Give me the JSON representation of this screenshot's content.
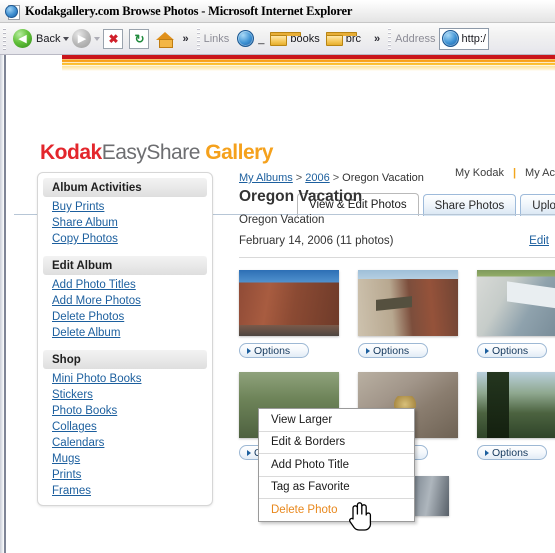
{
  "window": {
    "title": "Kodakgallery.com  Browse Photos - Microsoft Internet Explorer",
    "app_icon": "ie-page-icon"
  },
  "toolbar": {
    "back_label": "Back",
    "forward_label": "",
    "stop_icon": "stop-icon",
    "refresh_icon": "refresh-icon",
    "home_icon": "home-icon",
    "overflow_label": "»",
    "links_label": "Links",
    "link_items": [
      {
        "label": "_",
        "icon": "ie-globe-icon"
      },
      {
        "label": "books",
        "icon": "folder-icon"
      },
      {
        "label": "brc",
        "icon": "folder-icon"
      }
    ],
    "links_overflow_label": "»",
    "address_label": "Address",
    "address_value": "http:/"
  },
  "brand": {
    "kodak": "Kodak",
    "easyshare": "EasyShare",
    "gallery": "Gallery",
    "band_colors": [
      "#c9151b",
      "#f79a15",
      "#fbb927",
      "#fde29a"
    ]
  },
  "top_links": [
    {
      "label": "My Kodak"
    },
    {
      "label": "My Ac"
    }
  ],
  "tabs": [
    {
      "label": "View & Edit Photos",
      "active": true
    },
    {
      "label": "Share Photos",
      "active": false
    },
    {
      "label": "Uplo",
      "active": false
    }
  ],
  "sidebar": {
    "sections": [
      {
        "heading": "Album Activities",
        "links": [
          "Buy Prints",
          "Share Album",
          "Copy Photos"
        ]
      },
      {
        "heading": "Edit Album",
        "links": [
          "Add Photo Titles",
          "Add More Photos",
          "Delete Photos",
          "Delete Album"
        ]
      },
      {
        "heading": "Shop",
        "links": [
          "Mini Photo Books",
          "Stickers",
          "Photo Books",
          "Collages",
          "Calendars",
          "Mugs",
          "Prints",
          "Frames"
        ]
      }
    ]
  },
  "main": {
    "breadcrumb": {
      "root": "My Albums",
      "sep1": ">",
      "year": "2006",
      "sep2": ">",
      "current": "Oregon Vacation"
    },
    "album_title": "Oregon Vacation",
    "album_description": "Oregon Vacation",
    "album_meta": "February 14, 2006 (11 photos)",
    "edit_link": "Edit",
    "options_label": "Options",
    "photos": [
      {
        "id": "photo-1",
        "alt": "brick-building",
        "style": "ph1"
      },
      {
        "id": "photo-2",
        "alt": "storefront-street",
        "style": "ph2"
      },
      {
        "id": "photo-3",
        "alt": "house-awning",
        "style": "ph3"
      },
      {
        "id": "photo-4",
        "alt": "rock-close-up",
        "style": "ph4"
      },
      {
        "id": "photo-5",
        "alt": "trees-landscape",
        "style": "ph5"
      },
      {
        "id": "photo-6",
        "alt": "grass-field",
        "style": "ph7"
      },
      {
        "id": "photo-7",
        "alt": "building-partial",
        "style": "ph6"
      }
    ]
  },
  "context_menu": {
    "items": [
      {
        "label": "View Larger",
        "highlighted": false
      },
      {
        "label": "Edit & Borders",
        "highlighted": false
      },
      {
        "label": "Add Photo Title",
        "highlighted": false
      },
      {
        "label": "Tag as Favorite",
        "highlighted": false
      },
      {
        "label": "Delete Photo",
        "highlighted": true
      }
    ],
    "highlight_color": "#e8881d"
  }
}
